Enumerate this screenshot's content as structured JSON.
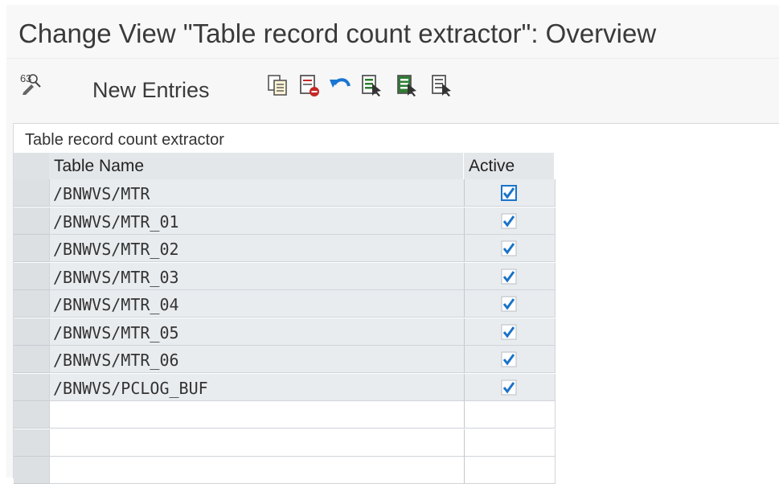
{
  "window": {
    "title": "Change View \"Table record count extractor\": Overview"
  },
  "toolbar": {
    "new_entries_label": "New Entries",
    "icons": [
      "display-change-icon",
      "copy-icon",
      "delete-icon",
      "undo-icon",
      "select-all-icon",
      "select-block-icon",
      "deselect-all-icon"
    ]
  },
  "panel": {
    "title": "Table record count extractor"
  },
  "table": {
    "columns": [
      "Table Name",
      "Active"
    ],
    "rows": [
      {
        "name": "/BNWVS/MTR",
        "active": true
      },
      {
        "name": "/BNWVS/MTR_01",
        "active": true
      },
      {
        "name": "/BNWVS/MTR_02",
        "active": true
      },
      {
        "name": "/BNWVS/MTR_03",
        "active": true
      },
      {
        "name": "/BNWVS/MTR_04",
        "active": true
      },
      {
        "name": "/BNWVS/MTR_05",
        "active": true
      },
      {
        "name": "/BNWVS/MTR_06",
        "active": true
      },
      {
        "name": "/BNWVS/PCLOG_BUF",
        "active": true
      }
    ]
  },
  "colors": {
    "check_blue": "#1a73c8",
    "save_green": "#2e7d32",
    "delete_red": "#c62828",
    "undo_blue": "#1976d2"
  }
}
